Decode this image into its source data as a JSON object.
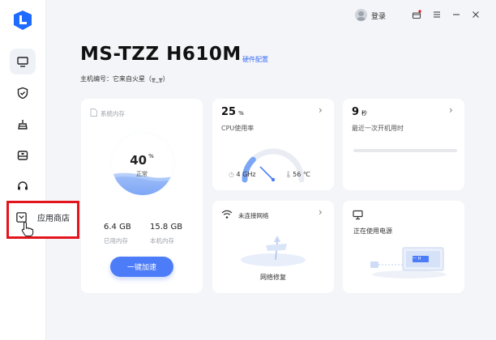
{
  "topbar": {
    "login_label": "登录"
  },
  "sidebar": {
    "items": [
      "monitor-icon",
      "shield-check-icon",
      "broom-icon",
      "toolbox-icon",
      "headset-icon"
    ],
    "app_store_label": "应用商店"
  },
  "header": {
    "title": "MS-TZZ H610M",
    "hw_config_link": "硬件配置",
    "host_id": "主机编号：它来自火星（╥_╥）"
  },
  "memory": {
    "title": "系统内存",
    "percent": "40",
    "percent_unit": "%",
    "percent_value": 40,
    "status": "正常",
    "used_value": "6.4 GB",
    "used_label": "已用内存",
    "total_value": "15.8 GB",
    "total_label": "本机内存",
    "accel_button": "一键加速"
  },
  "cpu": {
    "usage": "25",
    "usage_unit": "%",
    "usage_value": 25,
    "label": "CPU使用率",
    "freq": "4 GHz",
    "temp": "56 ℃"
  },
  "boot": {
    "value": "9",
    "unit": "秒",
    "label": "最近一次开机用时"
  },
  "network": {
    "title": "未连接网络",
    "repair_label": "网络修复"
  },
  "power": {
    "title": "正在使用电源",
    "screen_text": "一 H"
  },
  "colors": {
    "accent": "#4d7cf8",
    "highlight": "#e3141b",
    "logo": "#1f6bff"
  }
}
